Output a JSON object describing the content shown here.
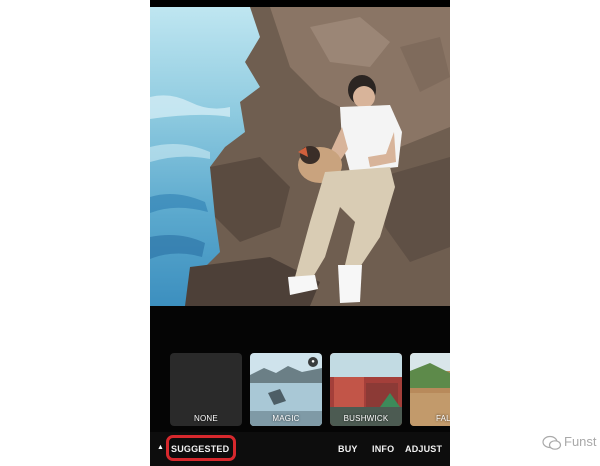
{
  "photo": {
    "description_icon": "photo-preview"
  },
  "filters": {
    "items": [
      {
        "label": "NONE",
        "locked": false
      },
      {
        "label": "MAGIC",
        "locked": true
      },
      {
        "label": "BUSHWICK",
        "locked": false
      },
      {
        "label": "FAL",
        "locked": false
      }
    ]
  },
  "bottom_bar": {
    "caret": "▲",
    "tabs": {
      "suggested": "SUGGESTED",
      "buy": "BUY",
      "info": "INFO",
      "adjust": "ADJUST"
    },
    "highlight_color": "#d7282d"
  },
  "watermark": {
    "text": "Funst"
  },
  "colors": {
    "background": "#000000",
    "text": "#f2f2f2",
    "accent": "#d7282d"
  }
}
